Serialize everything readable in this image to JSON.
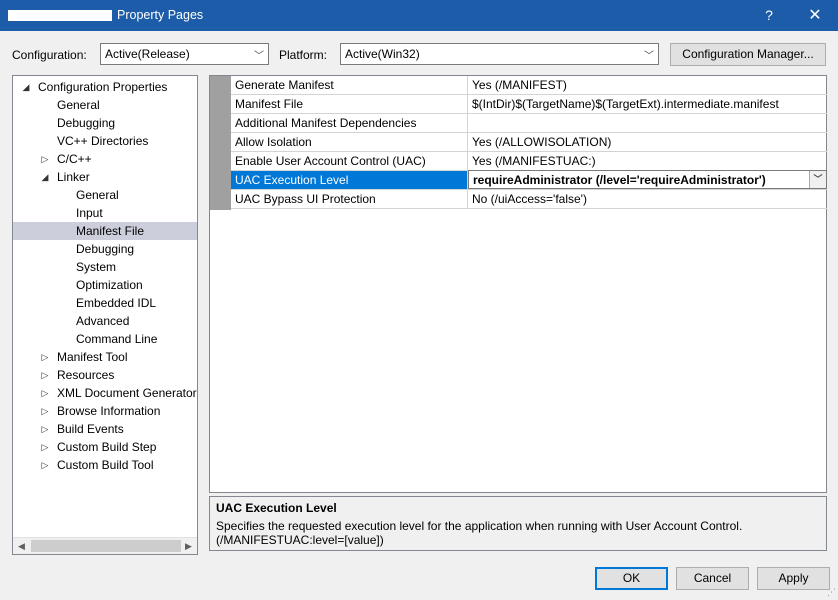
{
  "window": {
    "title": "Property Pages",
    "help_glyph": "?",
    "close_glyph": "✕"
  },
  "config": {
    "configuration_label": "Configuration:",
    "configuration_value": "Active(Release)",
    "platform_label": "Platform:",
    "platform_value": "Active(Win32)",
    "manager_button": "Configuration Manager..."
  },
  "tree": {
    "items": [
      {
        "label": "Configuration Properties",
        "level": 0,
        "twisty": "◢"
      },
      {
        "label": "General",
        "level": 1,
        "twisty": ""
      },
      {
        "label": "Debugging",
        "level": 1,
        "twisty": ""
      },
      {
        "label": "VC++ Directories",
        "level": 1,
        "twisty": ""
      },
      {
        "label": "C/C++",
        "level": 1,
        "twisty": "▷"
      },
      {
        "label": "Linker",
        "level": 1,
        "twisty": "◢"
      },
      {
        "label": "General",
        "level": 2,
        "twisty": ""
      },
      {
        "label": "Input",
        "level": 2,
        "twisty": ""
      },
      {
        "label": "Manifest File",
        "level": 2,
        "twisty": "",
        "selected": true
      },
      {
        "label": "Debugging",
        "level": 2,
        "twisty": ""
      },
      {
        "label": "System",
        "level": 2,
        "twisty": ""
      },
      {
        "label": "Optimization",
        "level": 2,
        "twisty": ""
      },
      {
        "label": "Embedded IDL",
        "level": 2,
        "twisty": ""
      },
      {
        "label": "Advanced",
        "level": 2,
        "twisty": ""
      },
      {
        "label": "Command Line",
        "level": 2,
        "twisty": ""
      },
      {
        "label": "Manifest Tool",
        "level": 1,
        "twisty": "▷"
      },
      {
        "label": "Resources",
        "level": 1,
        "twisty": "▷"
      },
      {
        "label": "XML Document Generator",
        "level": 1,
        "twisty": "▷"
      },
      {
        "label": "Browse Information",
        "level": 1,
        "twisty": "▷"
      },
      {
        "label": "Build Events",
        "level": 1,
        "twisty": "▷"
      },
      {
        "label": "Custom Build Step",
        "level": 1,
        "twisty": "▷"
      },
      {
        "label": "Custom Build Tool",
        "level": 1,
        "twisty": "▷"
      }
    ],
    "scroll_left": "◀",
    "scroll_right": "▶"
  },
  "grid": {
    "rows": [
      {
        "name": "Generate Manifest",
        "value": "Yes (/MANIFEST)"
      },
      {
        "name": "Manifest File",
        "value": "$(IntDir)$(TargetName)$(TargetExt).intermediate.manifest"
      },
      {
        "name": "Additional Manifest Dependencies",
        "value": ""
      },
      {
        "name": "Allow Isolation",
        "value": "Yes (/ALLOWISOLATION)"
      },
      {
        "name": "Enable User Account Control (UAC)",
        "value": "Yes (/MANIFESTUAC:)"
      },
      {
        "name": "UAC Execution Level",
        "value": "requireAdministrator (/level='requireAdministrator')",
        "selected": true
      },
      {
        "name": "UAC Bypass UI Protection",
        "value": "No (/uiAccess='false')"
      }
    ]
  },
  "description": {
    "title": "UAC Execution Level",
    "text": "Specifies the requested execution level for the application when running with User Account Control. (/MANIFESTUAC:level=[value])"
  },
  "buttons": {
    "ok": "OK",
    "cancel": "Cancel",
    "apply": "Apply"
  }
}
